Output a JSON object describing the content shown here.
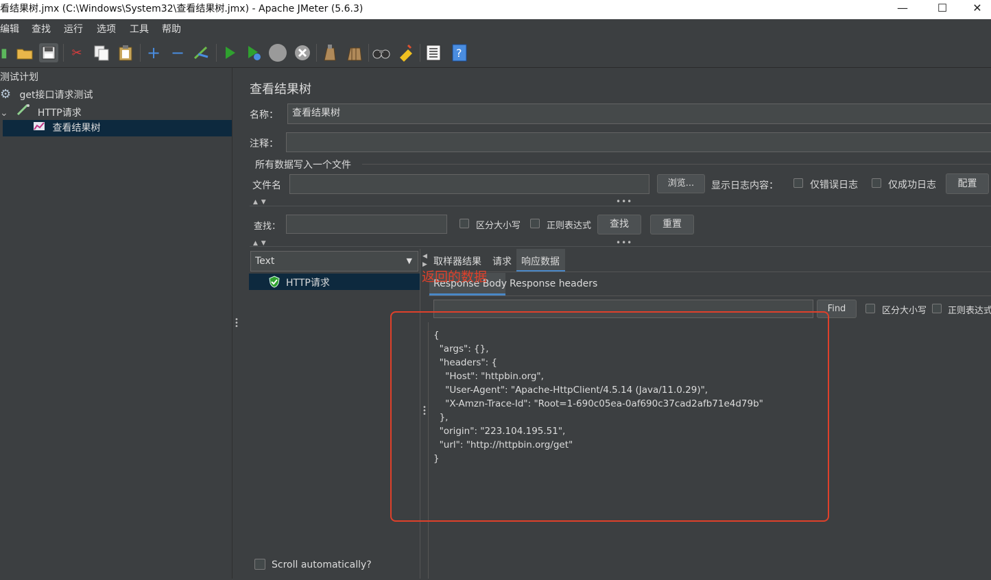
{
  "window": {
    "title": "看结果树.jmx (C:\\Windows\\System32\\查看结果树.jmx) - Apache JMeter (5.6.3)",
    "minimize": "—",
    "maximize": "☐",
    "close": "✕"
  },
  "menu": [
    "编辑",
    "查找",
    "运行",
    "选项",
    "工具",
    "帮助"
  ],
  "toolbar_icons": [
    "open-icon",
    "open-folder-icon",
    "save-icon",
    "cut-icon",
    "copy-icon",
    "paste-icon",
    "expand-icon",
    "collapse-icon",
    "toggle-icon",
    "start-icon",
    "start-no-pause-icon",
    "stop-icon",
    "shutdown-icon",
    "clear-icon",
    "clear-all-icon",
    "search-icon",
    "reset-search-icon",
    "function-helper-icon",
    "help-icon"
  ],
  "tree": {
    "items": [
      {
        "label": "测试计划"
      },
      {
        "label": "get接口请求测试"
      },
      {
        "label": "HTTP请求"
      },
      {
        "label": "查看结果树"
      }
    ]
  },
  "panel": {
    "heading": "查看结果树",
    "name_label": "名称：",
    "name_value": "查看结果树",
    "comment_label": "注释：",
    "comment_value": "",
    "file_group": "所有数据写入一个文件",
    "filename_label": "文件名",
    "filename_value": "",
    "browse": "浏览...",
    "log_label": "显示日志内容：",
    "errors_only": "仅错误日志",
    "success_only": "仅成功日志",
    "config": "配置",
    "search_label": "查找：",
    "search_value": "",
    "case_sensitive": "区分大小写",
    "regex": "正则表达式",
    "find_btn": "查找",
    "reset_btn": "重置"
  },
  "results": {
    "renderer": "Text",
    "sample": "HTTP请求",
    "tabs": [
      "取样器结果",
      "请求",
      "响应数据"
    ],
    "subtabs": [
      "Response Body",
      "Response headers"
    ],
    "annotation": "返回的数据",
    "find_value": "",
    "find_btn": "Find",
    "case_sensitive": "区分大小写",
    "regex": "正则表达式",
    "scroll_auto": "Scroll automatically?",
    "body": "{\n  \"args\": {},\n  \"headers\": {\n    \"Host\": \"httpbin.org\",\n    \"User-Agent\": \"Apache-HttpClient/4.5.14 (Java/11.0.29)\",\n    \"X-Amzn-Trace-Id\": \"Root=1-690c05ea-0af690c37cad2afb71e4d79b\"\n  },\n  \"origin\": \"223.104.195.51\",\n  \"url\": \"http://httpbin.org/get\"\n}"
  },
  "colors": {
    "background": "#3c3f41",
    "selection": "#0d293e",
    "active_tab_underline": "#4a88c7",
    "annotation_red": "#e0402a"
  }
}
